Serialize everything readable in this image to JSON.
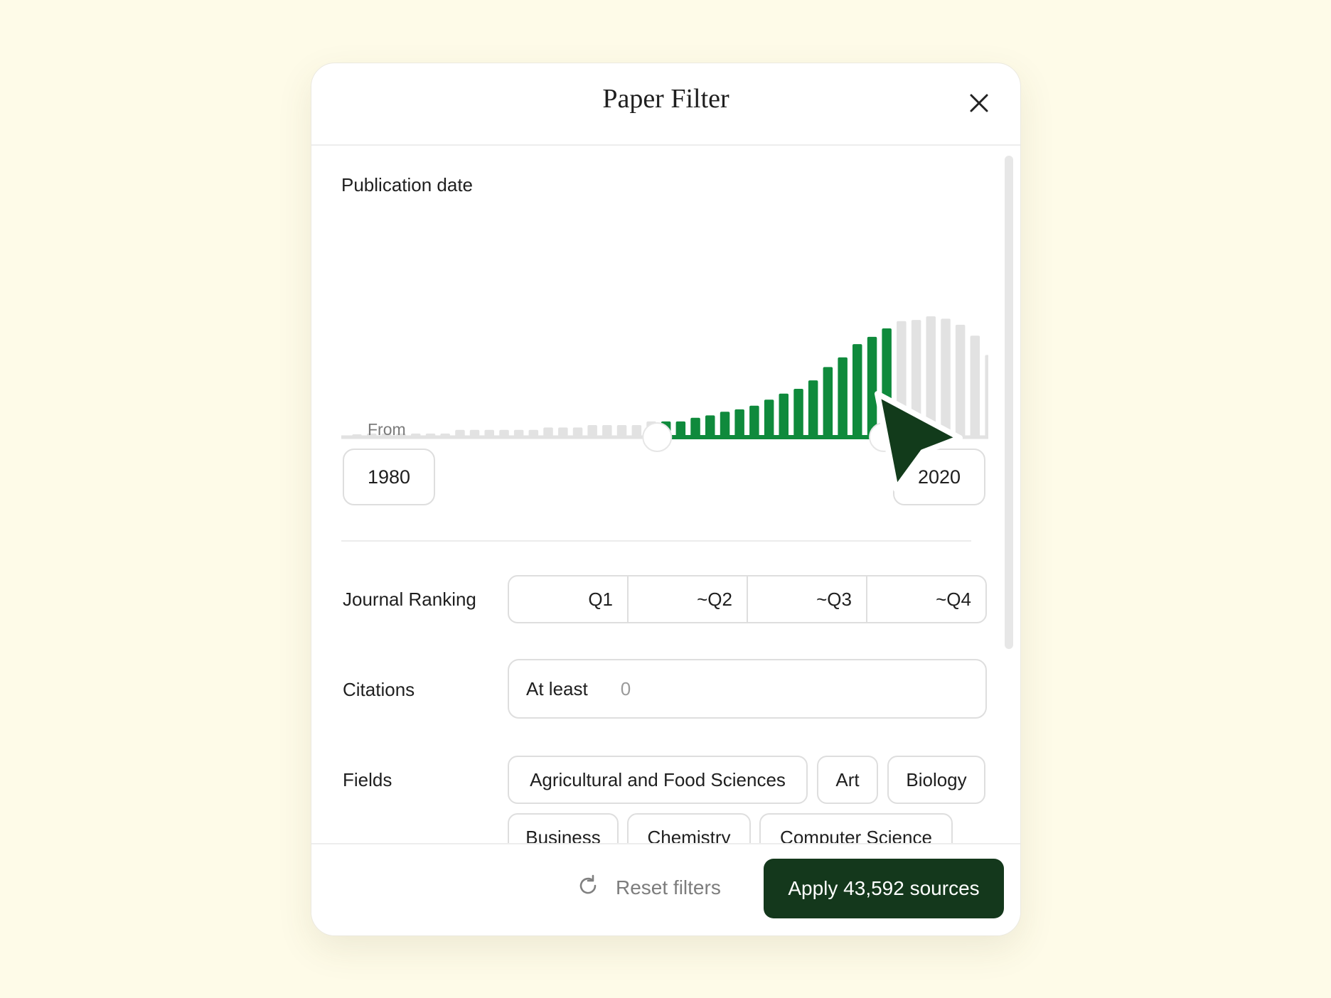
{
  "dialog": {
    "title": "Paper Filter"
  },
  "publication_date": {
    "label": "Publication date",
    "from_label": "From",
    "from_value": "1980",
    "to_value": "2020",
    "colors": {
      "selected": "#0f8a3c",
      "unselected": "#e2e2e2",
      "track": "#e2e2e2"
    },
    "histogram": {
      "selected_start_index": 21,
      "selected_end_index": 36,
      "bar_levels": [
        0.02,
        0.03,
        0.03,
        0.03,
        0.03,
        0.03,
        0.03,
        0.06,
        0.06,
        0.06,
        0.06,
        0.06,
        0.06,
        0.08,
        0.08,
        0.08,
        0.1,
        0.1,
        0.1,
        0.1,
        0.13,
        0.13,
        0.13,
        0.16,
        0.18,
        0.21,
        0.23,
        0.26,
        0.31,
        0.36,
        0.4,
        0.47,
        0.58,
        0.66,
        0.77,
        0.83,
        0.9,
        0.96,
        0.97,
        1.0,
        0.98,
        0.93,
        0.84,
        0.68
      ]
    }
  },
  "journal_ranking": {
    "label": "Journal Ranking",
    "options": [
      "Q1",
      "~Q2",
      "~Q3",
      "~Q4"
    ]
  },
  "citations": {
    "label": "Citations",
    "prefix": "At least",
    "placeholder": "0"
  },
  "fields": {
    "label": "Fields",
    "chips": [
      "Agricultural and Food Sciences",
      "Art",
      "Biology",
      "Business",
      "Chemistry",
      "Computer Science"
    ]
  },
  "footer": {
    "reset_label": "Reset filters",
    "apply_label": "Apply 43,592 sources"
  },
  "cursor": {
    "color": "#123b1b"
  }
}
